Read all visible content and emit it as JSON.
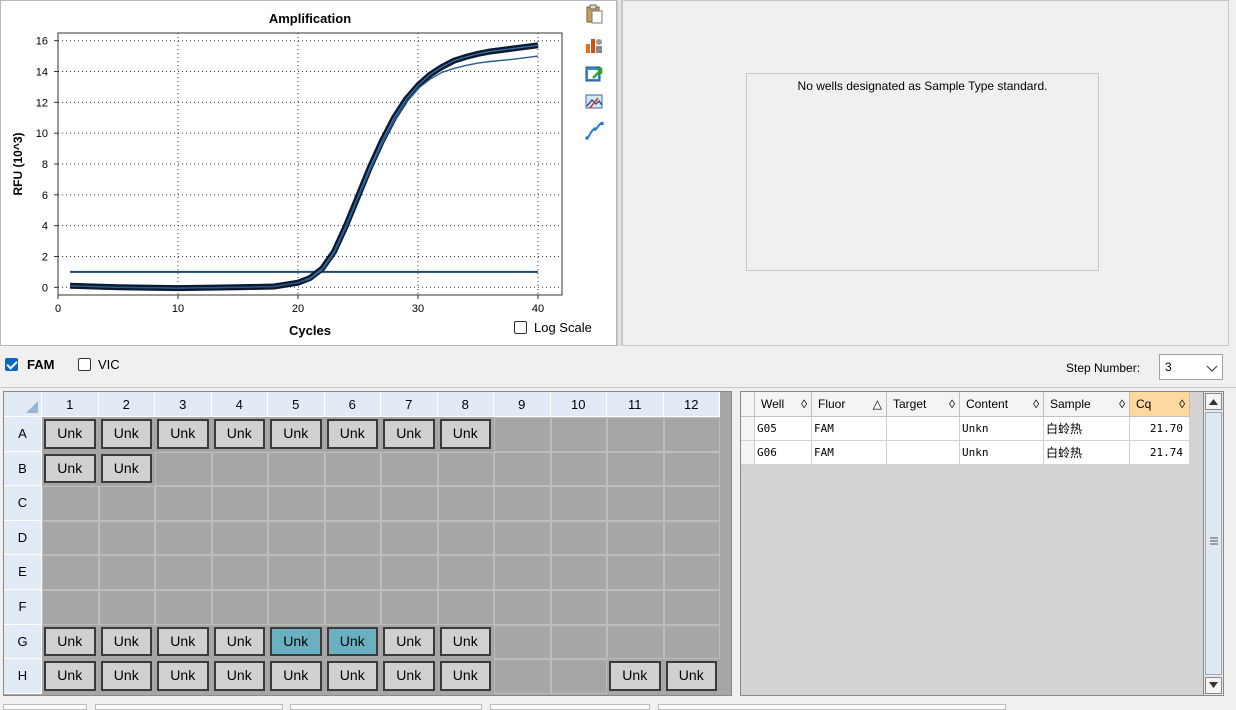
{
  "chart_data": {
    "type": "line",
    "title": "Amplification",
    "xlabel": "Cycles",
    "ylabel": "RFU (10^3)",
    "xlim": [
      0,
      42
    ],
    "ylim": [
      -0.5,
      16.5
    ],
    "x_ticks": [
      0,
      10,
      20,
      30,
      40
    ],
    "y_ticks": [
      0,
      2,
      4,
      6,
      8,
      10,
      12,
      14,
      16
    ],
    "grid": true,
    "threshold": 1.0,
    "series": [
      {
        "color": "#0b1830",
        "x": [
          1,
          5,
          10,
          15,
          18,
          20,
          21,
          22,
          23,
          24,
          25,
          26,
          27,
          28,
          29,
          30,
          31,
          32,
          33,
          34,
          35,
          36,
          38,
          40
        ],
        "y": [
          0.1,
          0,
          -0.05,
          0,
          0.05,
          0.3,
          0.6,
          1.2,
          2.3,
          4.0,
          5.9,
          7.8,
          9.5,
          11.0,
          12.2,
          13.1,
          13.8,
          14.3,
          14.7,
          14.95,
          15.15,
          15.3,
          15.5,
          15.7
        ]
      },
      {
        "color": "#2a5a8a",
        "x": [
          1,
          5,
          10,
          15,
          18,
          20,
          21,
          22,
          23,
          24,
          25,
          26,
          27,
          28,
          29,
          30,
          31,
          32,
          33,
          34,
          35,
          36,
          38,
          40
        ],
        "y": [
          0.1,
          0,
          -0.05,
          0,
          0.05,
          0.3,
          0.55,
          1.1,
          2.2,
          3.9,
          5.8,
          7.6,
          9.3,
          10.8,
          12.0,
          12.9,
          13.5,
          13.95,
          14.2,
          14.4,
          14.55,
          14.65,
          14.8,
          15.0
        ]
      }
    ]
  },
  "log_scale_label": "Log Scale",
  "toolbar_icons": [
    "clipboard-icon",
    "bar-chart-icon",
    "export-icon",
    "image-icon",
    "curve-icon"
  ],
  "standard_message": "No wells designated as Sample Type standard.",
  "fluors": [
    {
      "label": "FAM",
      "checked": true
    },
    {
      "label": "VIC",
      "checked": false
    }
  ],
  "step_label": "Step Number:",
  "step_value": "3",
  "plate": {
    "columns": [
      "1",
      "2",
      "3",
      "4",
      "5",
      "6",
      "7",
      "8",
      "9",
      "10",
      "11",
      "12"
    ],
    "rows": [
      "A",
      "B",
      "C",
      "D",
      "E",
      "F",
      "G",
      "H"
    ],
    "wells": {
      "A": [
        "Unk",
        "Unk",
        "Unk",
        "Unk",
        "Unk",
        "Unk",
        "Unk",
        "Unk",
        "",
        "",
        "",
        ""
      ],
      "B": [
        "Unk",
        "Unk",
        "",
        "",
        "",
        "",
        "",
        "",
        "",
        "",
        "",
        ""
      ],
      "C": [
        "",
        "",
        "",
        "",
        "",
        "",
        "",
        "",
        "",
        "",
        "",
        ""
      ],
      "D": [
        "",
        "",
        "",
        "",
        "",
        "",
        "",
        "",
        "",
        "",
        "",
        ""
      ],
      "E": [
        "",
        "",
        "",
        "",
        "",
        "",
        "",
        "",
        "",
        "",
        "",
        ""
      ],
      "F": [
        "",
        "",
        "",
        "",
        "",
        "",
        "",
        "",
        "",
        "",
        "",
        ""
      ],
      "G": [
        "Unk",
        "Unk",
        "Unk",
        "Unk",
        "Unk",
        "Unk",
        "Unk",
        "Unk",
        "",
        "",
        "",
        ""
      ],
      "H": [
        "Unk",
        "Unk",
        "Unk",
        "Unk",
        "Unk",
        "Unk",
        "Unk",
        "Unk",
        "",
        "",
        "Unk",
        "Unk"
      ]
    },
    "selected": [
      "G5",
      "G6"
    ]
  },
  "results_table": {
    "columns": [
      {
        "label": "Well",
        "sort": "◊"
      },
      {
        "label": "Fluor",
        "sort": "△"
      },
      {
        "label": "Target",
        "sort": "◊"
      },
      {
        "label": "Content",
        "sort": "◊"
      },
      {
        "label": "Sample",
        "sort": "◊"
      },
      {
        "label": "Cq",
        "sort": "◊"
      }
    ],
    "rows": [
      [
        "G05",
        "FAM",
        "",
        "Unkn",
        "白蛉热",
        "21.70"
      ],
      [
        "G06",
        "FAM",
        "",
        "Unkn",
        "白蛉热",
        "21.74"
      ]
    ]
  }
}
